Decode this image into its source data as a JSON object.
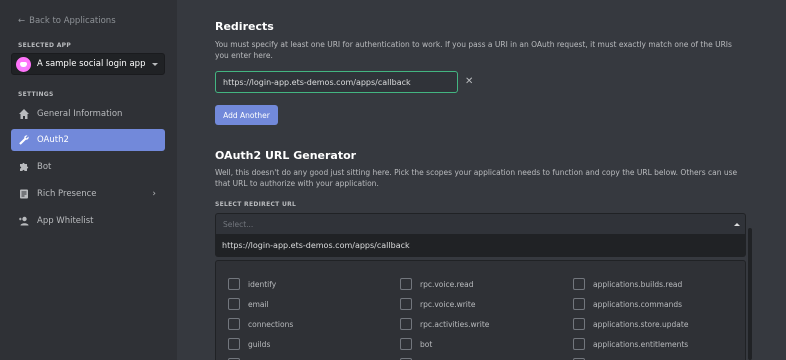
{
  "sidebar": {
    "back_label": "Back to Applications",
    "selected_app_heading": "SELECTED APP",
    "app_name": "A sample social login app",
    "settings_heading": "SETTINGS",
    "items": [
      {
        "label": "General Information",
        "icon": "home-icon"
      },
      {
        "label": "OAuth2",
        "icon": "wrench-icon"
      },
      {
        "label": "Bot",
        "icon": "puzzle-icon"
      },
      {
        "label": "Rich Presence",
        "icon": "document-icon"
      },
      {
        "label": "App Whitelist",
        "icon": "person-add-icon"
      }
    ],
    "accent": "#7289da"
  },
  "redirects": {
    "title": "Redirects",
    "description": "You must specify at least one URI for authentication to work. If you pass a URI in an OAuth request, it must exactly match one of the URIs you enter here.",
    "uri_value": "https://login-app.ets-demos.com/apps/callback",
    "remove_glyph": "✕",
    "add_button": "Add Another"
  },
  "generator": {
    "title": "OAuth2 URL Generator",
    "description": "Well, this doesn't do any good just sitting here. Pick the scopes your application needs to function and copy the URL below. Others can use that URL to authorize with your application.",
    "select_label": "SELECT REDIRECT URL",
    "select_placeholder": "Select...",
    "option": "https://login-app.ets-demos.com/apps/callback",
    "scopes": [
      [
        "identify",
        "rpc.voice.read",
        "applications.builds.read"
      ],
      [
        "email",
        "rpc.voice.write",
        "applications.commands"
      ],
      [
        "connections",
        "rpc.activities.write",
        "applications.store.update"
      ],
      [
        "guilds",
        "bot",
        "applications.entitlements"
      ]
    ]
  }
}
